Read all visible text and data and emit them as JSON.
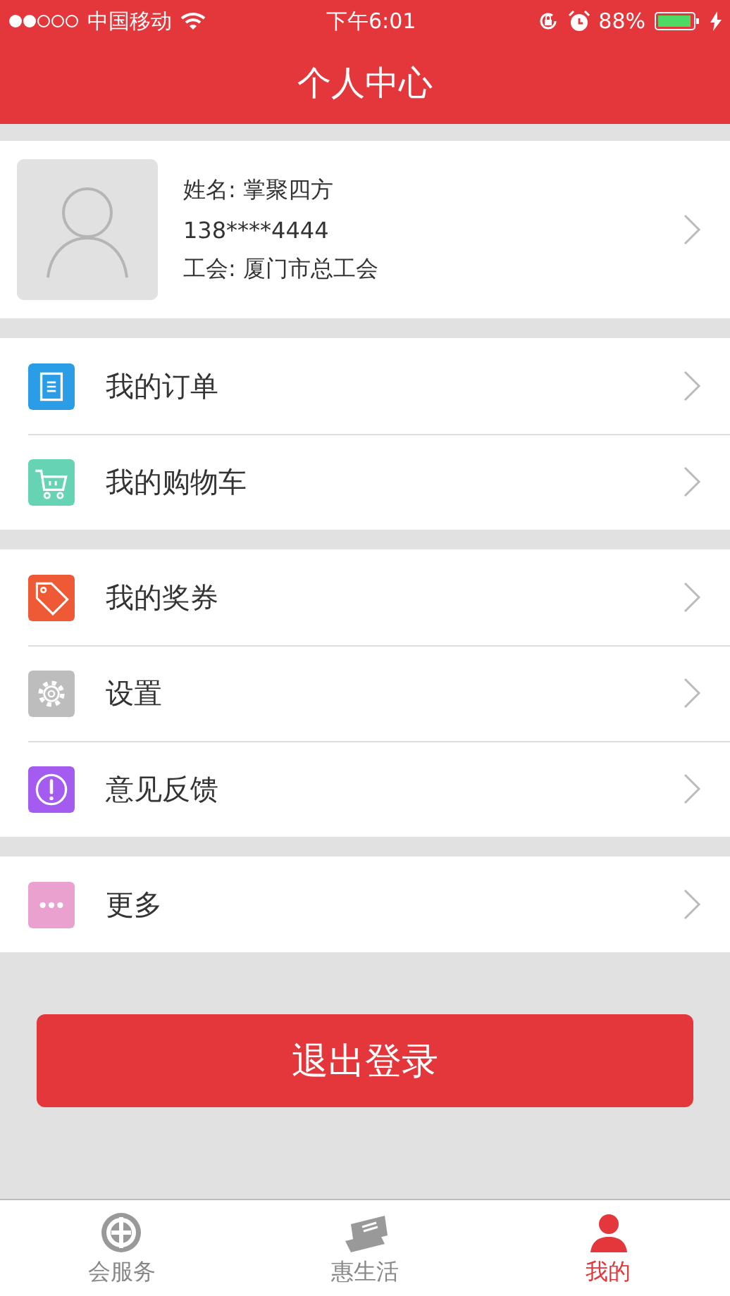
{
  "status_bar": {
    "carrier": "中国移动",
    "time": "下午6:01",
    "battery": "88%"
  },
  "nav": {
    "title": "个人中心"
  },
  "profile": {
    "name": "姓名: 掌聚四方",
    "phone": "138****4444",
    "union": "工会: 厦门市总工会"
  },
  "menu_groups": [
    [
      {
        "kind": "order",
        "label": "我的订单",
        "color": "#2a9de6"
      },
      {
        "kind": "cart",
        "label": "我的购物车",
        "color": "#66d4b4"
      }
    ],
    [
      {
        "kind": "coupon",
        "label": "我的奖券",
        "color": "#ee5a35"
      },
      {
        "kind": "settings",
        "label": "设置",
        "color": "#bdbdbd"
      },
      {
        "kind": "feedback",
        "label": "意见反馈",
        "color": "#a45bf0"
      }
    ],
    [
      {
        "kind": "more",
        "label": "更多",
        "color": "#eaa1cf"
      }
    ]
  ],
  "logout_button": "退出登录",
  "tabs": [
    {
      "kind": "service",
      "label": "会服务",
      "selected": false
    },
    {
      "kind": "life",
      "label": "惠生活",
      "selected": false
    },
    {
      "kind": "me",
      "label": "我的",
      "selected": true
    }
  ]
}
